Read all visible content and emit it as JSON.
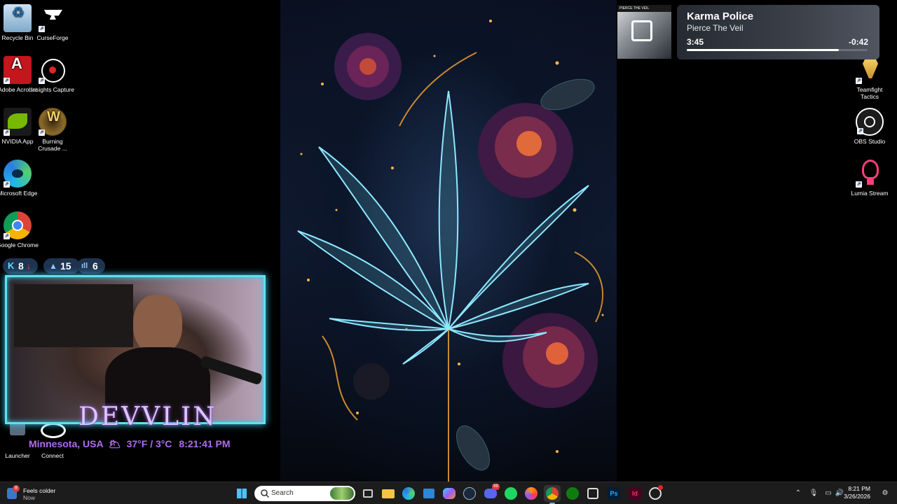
{
  "desktop": {
    "left_icons": [
      {
        "label": "Recycle Bin",
        "icon": "recycle-bin-icon"
      },
      {
        "label": "CurseForge",
        "icon": "curseforge-icon"
      },
      {
        "label": "Adobe Acrobat",
        "icon": "adobe-acrobat-icon"
      },
      {
        "label": "Insights Capture",
        "icon": "insights-capture-icon"
      },
      {
        "label": "NVIDIA App",
        "icon": "nvidia-icon"
      },
      {
        "label": "Burning Crusade ...",
        "icon": "burning-crusade-icon"
      },
      {
        "label": "Microsoft Edge",
        "icon": "edge-icon"
      },
      {
        "label": "Google Chrome",
        "icon": "chrome-icon"
      },
      {
        "label": "Launcher",
        "icon": "launcher-icon"
      },
      {
        "label": "Connect",
        "icon": "connect-icon"
      }
    ],
    "right_icons": [
      {
        "label": "Teamfight Tactics",
        "icon": "teamfight-tactics-icon"
      },
      {
        "label": "OBS Studio",
        "icon": "obs-studio-icon"
      },
      {
        "label": "Lumia Stream",
        "icon": "lumia-stream-icon"
      }
    ]
  },
  "media": {
    "album_band": "PIERCE THE VEIL",
    "title": "Karma Police",
    "artist": "Pierce The Veil",
    "elapsed": "3:45",
    "remaining": "-0:42",
    "progress": 0.84
  },
  "stream_stats": {
    "kick": "8",
    "followers": "15",
    "viewers": "6"
  },
  "overlay": {
    "streamer_name": "DEVVLIN",
    "weather_line": "Minnesota, USA",
    "weather_emoji": "🌥",
    "temp": "37°F / 3°C",
    "time": "8:21:41 PM"
  },
  "taskbar": {
    "weather_title": "Feels colder",
    "weather_sub": "Now",
    "weather_badge": "8",
    "search_placeholder": "Search",
    "clock_time": "8:21 PM",
    "clock_date": "3/26/2026",
    "discord_badge": "99"
  },
  "colors": {
    "taskbar_bg": "#1c1c1c",
    "cam_border": "#5fe0f0",
    "overlay_purple": "#b06cf0"
  }
}
